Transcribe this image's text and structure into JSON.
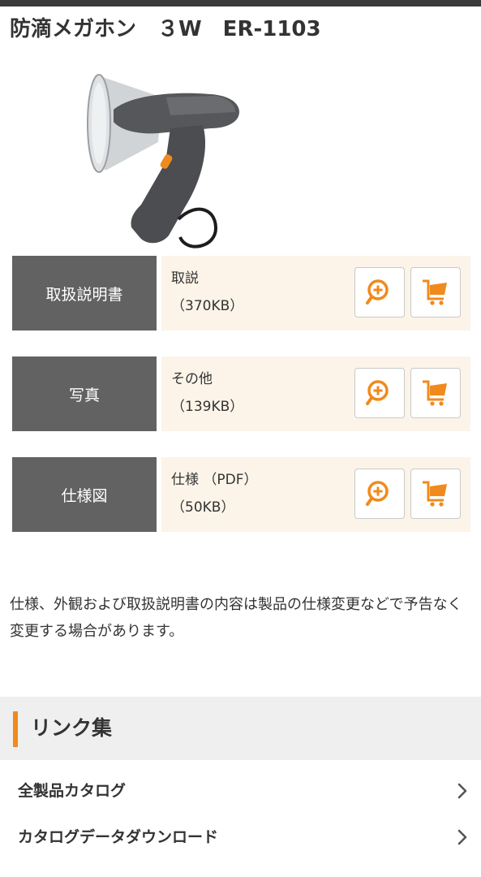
{
  "product": {
    "title": "防滴メガホン　３W　ER-1103"
  },
  "documents": [
    {
      "label": "取扱説明書",
      "name": "取説",
      "size": "（370KB）"
    },
    {
      "label": "写真",
      "name": "その他",
      "size": "（139KB）"
    },
    {
      "label": "仕様図",
      "name": "仕様 （PDF）",
      "size": "（50KB）"
    }
  ],
  "icons": {
    "zoom": "zoom-in-icon",
    "cart": "cart-icon",
    "chevron": "chevron-right-icon"
  },
  "colors": {
    "accent": "#f08a1c",
    "label_bg": "#626262",
    "body_bg": "#fcf4e9"
  },
  "notice": "仕様、外観および取扱説明書の内容は製品の仕様変更などで予告なく変更する場合があります。",
  "links": {
    "title": "リンク集",
    "items": [
      {
        "label": "全製品カタログ"
      },
      {
        "label": "カタログデータダウンロード"
      }
    ]
  }
}
